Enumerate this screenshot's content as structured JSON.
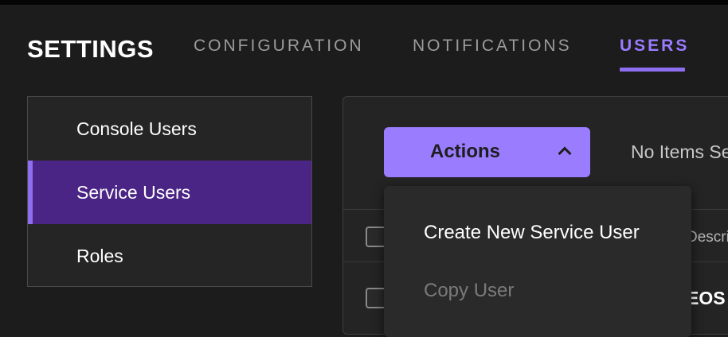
{
  "header": {
    "title": "SETTINGS",
    "tabs": [
      {
        "label": "CONFIGURATION"
      },
      {
        "label": "NOTIFICATIONS"
      },
      {
        "label": "USERS",
        "active": true
      }
    ]
  },
  "sidebar": {
    "items": [
      {
        "label": "Console Users"
      },
      {
        "label": "Service Users",
        "selected": true
      },
      {
        "label": "Roles"
      }
    ]
  },
  "toolbar": {
    "actions_label": "Actions",
    "selection_status": "No Items Selected"
  },
  "dropdown": {
    "items": [
      {
        "label": "Create New Service User",
        "enabled": true
      },
      {
        "label": "Copy User",
        "enabled": false
      }
    ]
  },
  "table": {
    "header_partial": "Description",
    "row1_partial": "EOS"
  },
  "colors": {
    "accent": "#8d6df0",
    "button": "#9a7cff",
    "selected_row": "#4a2585",
    "background": "#1c1c1c"
  }
}
